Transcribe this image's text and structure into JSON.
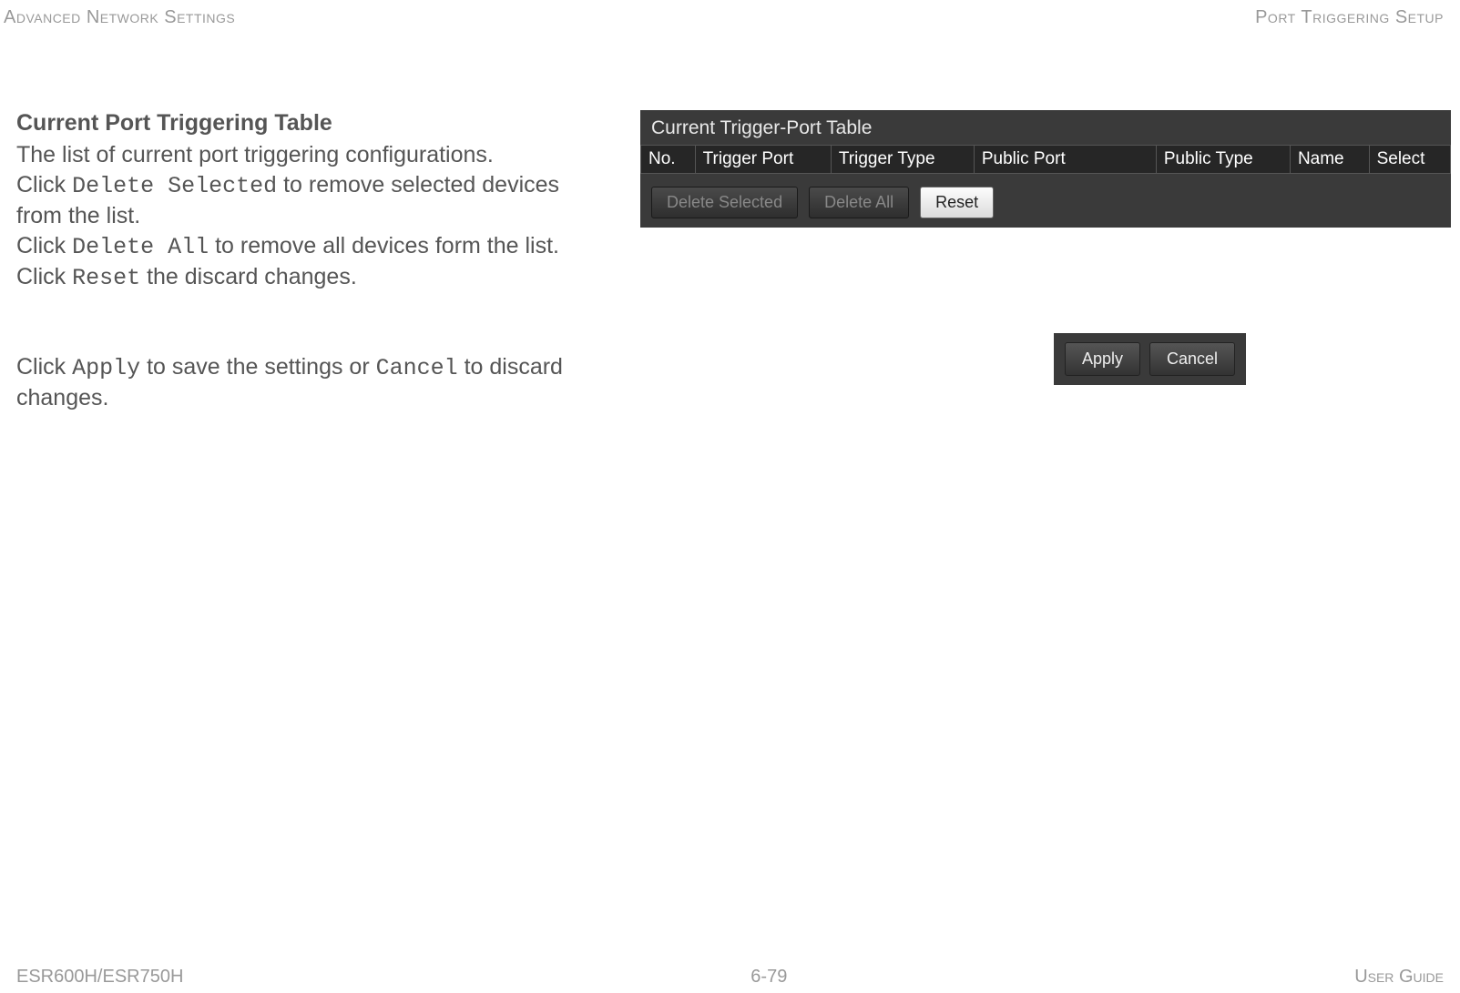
{
  "header": {
    "left": "Advanced Network Settings",
    "right": "Port Triggering Setup"
  },
  "section1": {
    "title": "Current Port Triggering Table",
    "line1": "The list of current port triggering configurations.",
    "line2a": "Click ",
    "line2b": "Delete Selected",
    "line2c": " to remove selected devices from the list.",
    "line3a": "Click ",
    "line3b": "Delete All",
    "line3c": " to remove all devices form the list.",
    "line4a": "Click ",
    "line4b": "Reset",
    "line4c": " the discard changes."
  },
  "section2": {
    "line1a": "Click ",
    "line1b": "Apply",
    "line1c": " to save the settings or ",
    "line1d": "Cancel",
    "line1e": " to discard changes."
  },
  "routerPanel": {
    "title": "Current Trigger-Port Table",
    "columns": {
      "no": "No.",
      "triggerPort": "Trigger Port",
      "triggerType": "Trigger Type",
      "publicPort": "Public Port",
      "publicType": "Public Type",
      "name": "Name",
      "select": "Select"
    },
    "buttons": {
      "deleteSelected": "Delete Selected",
      "deleteAll": "Delete All",
      "reset": "Reset"
    }
  },
  "applyCancel": {
    "apply": "Apply",
    "cancel": "Cancel"
  },
  "footer": {
    "left": "ESR600H/ESR750H",
    "center": "6-79",
    "right": "User Guide"
  }
}
